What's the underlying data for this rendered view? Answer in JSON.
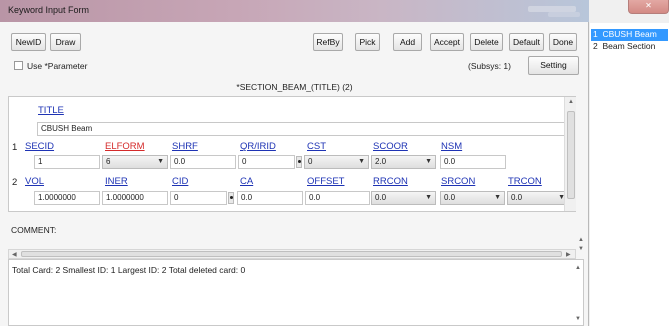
{
  "window": {
    "title": "Keyword Input Form",
    "close_label": ""
  },
  "toolbar": {
    "left": [
      "NewID",
      "Draw"
    ],
    "right": [
      "RefBy",
      "Pick",
      "Add",
      "Accept",
      "Delete",
      "Default",
      "Done"
    ]
  },
  "options": {
    "use_parameter": "Use *Parameter",
    "subsys": "(Subsys: 1)",
    "setting": "Setting"
  },
  "card_title": "*SECTION_BEAM_(TITLE)   (2)",
  "form": {
    "title_label": "TITLE",
    "title_value": "CBUSH Beam",
    "row1_num": "1",
    "row1_labels": [
      "SECID",
      "ELFORM",
      "SHRF",
      "QR/IRID",
      "CST",
      "SCOOR",
      "NSM"
    ],
    "row1_values": {
      "secid": "1",
      "elform": "6",
      "shrf": "0.0",
      "qr": "0",
      "cst": "0",
      "scoor": "2.0",
      "nsm": "0.0"
    },
    "row2_num": "2",
    "row2_labels": [
      "VOL",
      "INER",
      "CID",
      "CA",
      "OFFSET",
      "RRCON",
      "SRCON",
      "TRCON"
    ],
    "row2_values": {
      "vol": "1.0000000",
      "iner": "1.0000000",
      "cid": "0",
      "ca": "0.0",
      "offset": "0.0",
      "rrcon": "0.0",
      "srcon": "0.0",
      "trcon": "0.0"
    }
  },
  "comment_label": "COMMENT:",
  "status": "Total Card: 2   Smallest ID: 1   Largest ID: 2   Total deleted card:  0",
  "list": [
    {
      "num": "1",
      "name": "CBUSH Beam",
      "selected": true
    },
    {
      "num": "2",
      "name": "Beam Section",
      "selected": false
    }
  ]
}
